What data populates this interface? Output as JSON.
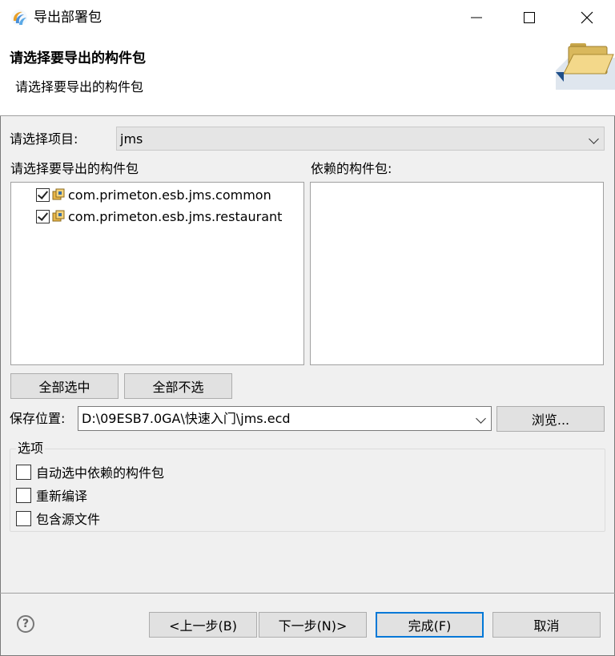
{
  "window": {
    "title": "导出部署包",
    "icon": "eclipse-swirl-icon"
  },
  "header": {
    "title": "请选择要导出的构件包",
    "description": "请选择要导出的构件包"
  },
  "project": {
    "label": "请选择项目:",
    "value": "jms"
  },
  "packages": {
    "label": "请选择要导出的构件包",
    "items": [
      {
        "label": "com.primeton.esb.jms.common",
        "checked": true
      },
      {
        "label": "com.primeton.esb.jms.restaurant",
        "checked": true
      }
    ]
  },
  "dependencies": {
    "label": "依赖的构件包:"
  },
  "buttons": {
    "select_all": "全部选中",
    "deselect_all": "全部不选",
    "browse": "浏览...",
    "back": "<上一步(B)",
    "next": "下一步(N)>",
    "finish": "完成(F)",
    "cancel": "取消"
  },
  "save": {
    "label": "保存位置:",
    "value": "D:\\09ESB7.0GA\\快速入门\\jms.ecd"
  },
  "options": {
    "legend": "选项",
    "items": [
      {
        "label": "自动选中依赖的构件包",
        "checked": false
      },
      {
        "label": "重新编译",
        "checked": false
      },
      {
        "label": "包含源文件",
        "checked": false
      }
    ]
  },
  "help": {
    "glyph": "?"
  },
  "colors": {
    "accent": "#0078d7",
    "window_bg": "#f0f0f0",
    "header_bg": "#ffffff"
  }
}
